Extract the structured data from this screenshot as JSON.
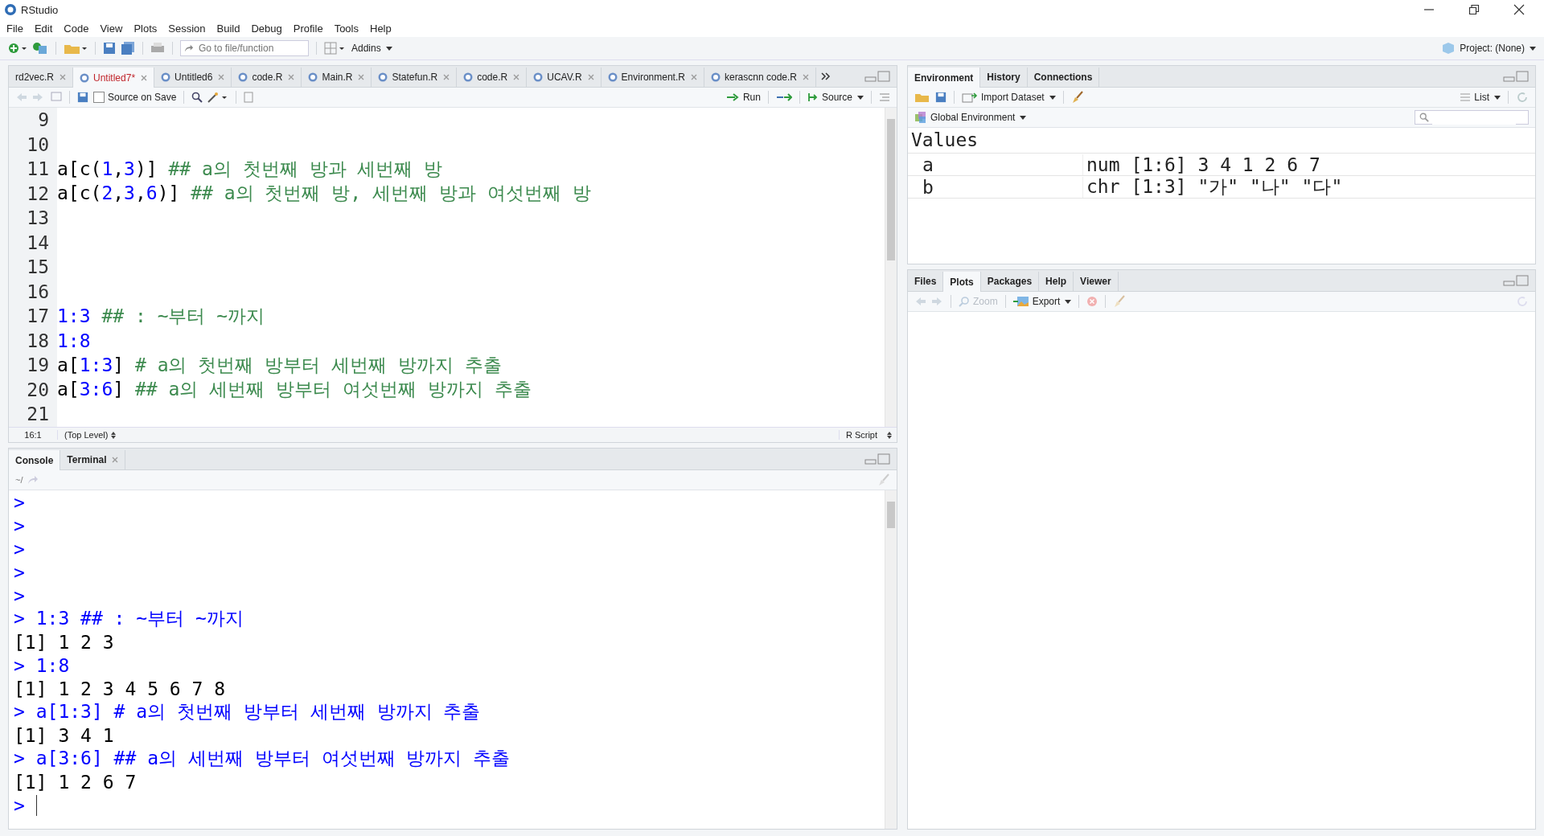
{
  "window": {
    "title": "RStudio"
  },
  "menu": [
    "File",
    "Edit",
    "Code",
    "View",
    "Plots",
    "Session",
    "Build",
    "Debug",
    "Profile",
    "Tools",
    "Help"
  ],
  "toolbar": {
    "goto_placeholder": "Go to file/function",
    "addins": "Addins",
    "project": "Project: (None)"
  },
  "editor": {
    "tabs": [
      {
        "label": "rd2vec.R",
        "selected": false,
        "modified": false
      },
      {
        "label": "Untitled7*",
        "selected": true,
        "modified": true
      },
      {
        "label": "Untitled6",
        "selected": false,
        "modified": false
      },
      {
        "label": "code.R",
        "selected": false,
        "modified": false
      },
      {
        "label": "Main.R",
        "selected": false,
        "modified": false
      },
      {
        "label": "Statefun.R",
        "selected": false,
        "modified": false
      },
      {
        "label": "code.R",
        "selected": false,
        "modified": false
      },
      {
        "label": "UCAV.R",
        "selected": false,
        "modified": false
      },
      {
        "label": "Environment.R",
        "selected": false,
        "modified": false
      },
      {
        "label": "kerascnn code.R",
        "selected": false,
        "modified": false
      }
    ],
    "source_on_save": {
      "label": "Source on Save",
      "checked": false
    },
    "run": "Run",
    "source": "Source",
    "lines": [
      {
        "number": "9"
      },
      {
        "number": "10"
      },
      {
        "number": "11",
        "tokens": [
          {
            "kind": "code",
            "text": "a[c("
          },
          {
            "kind": "number",
            "text": "1"
          },
          {
            "kind": "code",
            "text": ","
          },
          {
            "kind": "number",
            "text": "3"
          },
          {
            "kind": "code",
            "text": ")] "
          },
          {
            "kind": "comment",
            "text": "## a의 첫번째 방과 세번째 방"
          }
        ]
      },
      {
        "number": "12",
        "tokens": [
          {
            "kind": "code",
            "text": "a[c("
          },
          {
            "kind": "number",
            "text": "2"
          },
          {
            "kind": "code",
            "text": ","
          },
          {
            "kind": "number",
            "text": "3"
          },
          {
            "kind": "code",
            "text": ","
          },
          {
            "kind": "number",
            "text": "6"
          },
          {
            "kind": "code",
            "text": ")] "
          },
          {
            "kind": "comment",
            "text": "## a의 첫번째 방, 세번째 방과 여섯번째 방"
          }
        ]
      },
      {
        "number": "13"
      },
      {
        "number": "14"
      },
      {
        "number": "15"
      },
      {
        "number": "16"
      },
      {
        "number": "17",
        "tokens": [
          {
            "kind": "number",
            "text": "1:3 "
          },
          {
            "kind": "comment",
            "text": "## : ~부터 ~까지"
          }
        ]
      },
      {
        "number": "18",
        "tokens": [
          {
            "kind": "number",
            "text": "1:8"
          }
        ]
      },
      {
        "number": "19",
        "tokens": [
          {
            "kind": "code",
            "text": "a["
          },
          {
            "kind": "number",
            "text": "1:3"
          },
          {
            "kind": "code",
            "text": "] "
          },
          {
            "kind": "comment",
            "text": "# a의 첫번째 방부터 세번째 방까지 추출"
          }
        ]
      },
      {
        "number": "20",
        "tokens": [
          {
            "kind": "code",
            "text": "a["
          },
          {
            "kind": "number",
            "text": "3:6"
          },
          {
            "kind": "code",
            "text": "] "
          },
          {
            "kind": "comment",
            "text": "## a의 세번째 방부터 여섯번째 방까지 추출"
          }
        ]
      },
      {
        "number": "21"
      }
    ],
    "status": {
      "position": "16:1",
      "scope": "(Top Level)",
      "type": "R Script"
    }
  },
  "console": {
    "tabs": [
      {
        "label": "Console",
        "selected": true,
        "closable": false
      },
      {
        "label": "Terminal",
        "selected": false,
        "closable": true
      }
    ],
    "path": "~/",
    "lines": [
      {
        "kind": "input",
        "text": ">"
      },
      {
        "kind": "input",
        "text": ">"
      },
      {
        "kind": "input",
        "text": ">"
      },
      {
        "kind": "input",
        "text": ">"
      },
      {
        "kind": "input",
        "text": ">"
      },
      {
        "kind": "input",
        "text": "> 1:3 ## : ~부터 ~까지"
      },
      {
        "kind": "output",
        "text": "[1] 1 2 3"
      },
      {
        "kind": "input",
        "text": "> 1:8"
      },
      {
        "kind": "output",
        "text": "[1] 1 2 3 4 5 6 7 8"
      },
      {
        "kind": "input",
        "text": "> a[1:3] # a의 첫번째 방부터 세번째 방까지 추출"
      },
      {
        "kind": "output",
        "text": "[1] 3 4 1"
      },
      {
        "kind": "input",
        "text": "> a[3:6] ## a의 세번째 방부터 여섯번째 방까지 추출"
      },
      {
        "kind": "output",
        "text": "[1] 1 2 6 7"
      },
      {
        "kind": "prompt",
        "text": ">"
      }
    ]
  },
  "environment": {
    "tabs": [
      {
        "label": "Environment",
        "selected": true
      },
      {
        "label": "History",
        "selected": false
      },
      {
        "label": "Connections",
        "selected": false
      }
    ],
    "import": "Import Dataset",
    "view": "List",
    "scope": "Global Environment",
    "section": "Values",
    "rows": [
      {
        "name": "a",
        "value": "num [1:6] 3 4 1 2 6 7"
      },
      {
        "name": "b",
        "value": "chr [1:3] \"가\" \"나\" \"다\""
      }
    ]
  },
  "files": {
    "tabs": [
      {
        "label": "Files",
        "selected": false
      },
      {
        "label": "Plots",
        "selected": true
      },
      {
        "label": "Packages",
        "selected": false
      },
      {
        "label": "Help",
        "selected": false
      },
      {
        "label": "Viewer",
        "selected": false
      }
    ],
    "zoom": "Zoom",
    "export": "Export"
  }
}
